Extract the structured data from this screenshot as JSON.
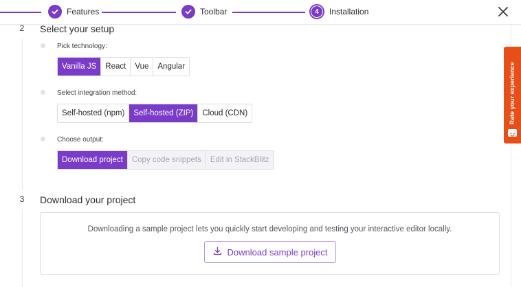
{
  "stepper": {
    "steps": [
      {
        "label": "Features",
        "state": "done"
      },
      {
        "label": "Toolbar",
        "state": "done"
      },
      {
        "label": "Installation",
        "state": "current",
        "number": "4"
      }
    ],
    "close_icon": "close-icon"
  },
  "sections": [
    {
      "number": "2",
      "title": "Select your setup",
      "groups": [
        {
          "label": "Pick technology:",
          "options": [
            "Vanilla JS",
            "React",
            "Vue",
            "Angular"
          ],
          "selected": "Vanilla JS"
        },
        {
          "label": "Select integration method:",
          "options": [
            "Self-hosted (npm)",
            "Self-hosted (ZIP)",
            "Cloud (CDN)"
          ],
          "selected": "Self-hosted (ZIP)"
        },
        {
          "label": "Choose output:",
          "options": [
            "Download project",
            "Copy code snippets",
            "Edit in StackBlitz"
          ],
          "selected": "Download project",
          "disabled": [
            "Copy code snippets",
            "Edit in StackBlitz"
          ]
        }
      ]
    },
    {
      "number": "3",
      "title": "Download your project",
      "description": "Downloading a sample project lets you quickly start developing and testing your interactive editor locally.",
      "button_label": "Download sample project",
      "button_icon": "download-icon"
    }
  ],
  "feedback_tab": {
    "label": "Rate your experience"
  },
  "colors": {
    "accent": "#7a3bc9",
    "feedback": "#e84e17",
    "disabled_bg": "#f3f3f5"
  }
}
